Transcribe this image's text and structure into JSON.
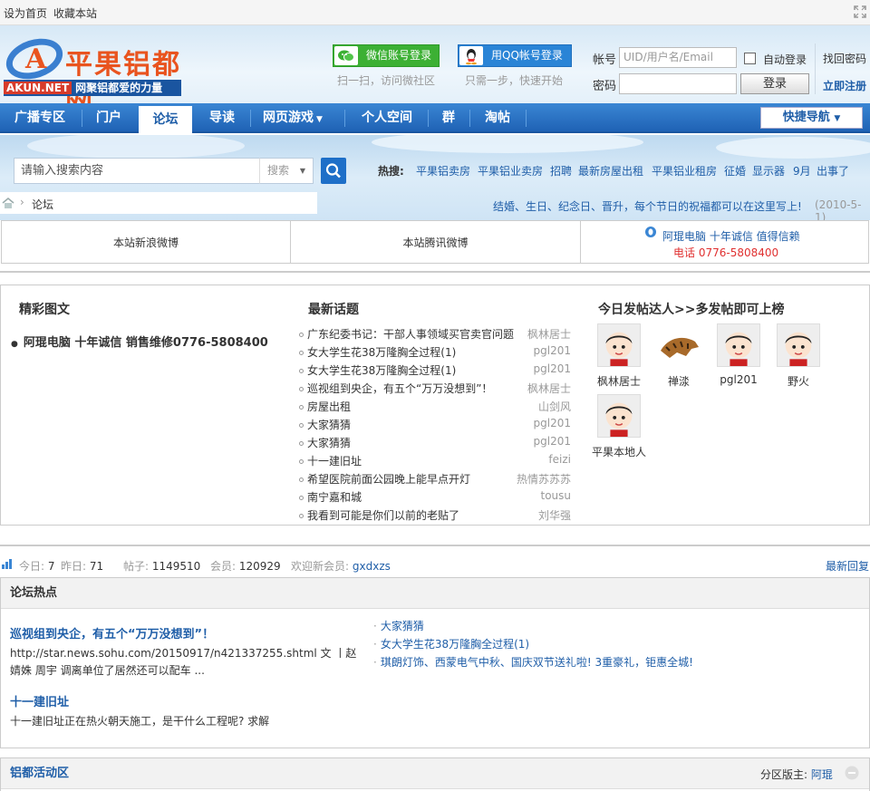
{
  "topbar": {
    "set_home": "设为首页",
    "bookmark": "收藏本站"
  },
  "brand": {
    "logo_text": "平果铝都网",
    "site_code": "AKUN.NET",
    "slogan": "网聚铝都爱的力量"
  },
  "social": {
    "wechat_btn": "微信账号登录",
    "wechat_tip": "扫一扫，访问微社区",
    "qq_btn": "用QQ帐号登录",
    "qq_tip": "只需一步，快速开始"
  },
  "login": {
    "username_label": "帐号",
    "username_placeholder": "UID/用户名/Email",
    "password_label": "密码",
    "password_value": "",
    "auto_login": "自动登录",
    "login_btn": "登录",
    "find_pwd": "找回密码",
    "register": "立即注册"
  },
  "nav": {
    "items": [
      "广播专区",
      "门户",
      "论坛",
      "导读",
      "网页游戏",
      "个人空间",
      "群",
      "淘帖"
    ],
    "active": "论坛",
    "quick": "快捷导航"
  },
  "search": {
    "placeholder": "请输入搜索内容",
    "scope": "搜索",
    "hot_label": "热搜:"
  },
  "hot_words": [
    "平果铝卖房",
    "平果铝业卖房",
    "招聘",
    "最新房屋出租",
    "平果铝业租房",
    "征婚",
    "显示器",
    "9月",
    "出事了"
  ],
  "breadcrumb": {
    "current": "论坛"
  },
  "notice": {
    "text": "结婚、生日、纪念日、晋升，每个节日的祝福都可以在这里写上!",
    "date": "(2010-5-1)"
  },
  "weibo": {
    "sina": "本站新浪微博",
    "tencent": "本站腾讯微博",
    "ad_line1": "阿琨电脑 十年诚信 值得信赖",
    "ad_phone_label": "电话",
    "ad_phone": "0776-5808400"
  },
  "featured": {
    "title": "精彩图文",
    "pick": "阿琨电脑 十年诚信 销售维修0776-5808400",
    "latest_title": "最新话题",
    "topics": [
      {
        "title": "广东纪委书记：干部人事领域买官卖官问题",
        "author": "枫林居士"
      },
      {
        "title": "女大学生花38万隆胸全过程(1)",
        "author": "pgl201"
      },
      {
        "title": "女大学生花38万隆胸全过程(1)",
        "author": "pgl201"
      },
      {
        "title": "巡视组到央企，有五个“万万没想到”！",
        "author": "枫林居士"
      },
      {
        "title": "房屋出租",
        "author": "山剑风"
      },
      {
        "title": "大家猜猜",
        "author": "pgl201"
      },
      {
        "title": "大家猜猜",
        "author": "pgl201"
      },
      {
        "title": "十一建旧址",
        "author": "feizi"
      },
      {
        "title": "希望医院前面公园晚上能早点开灯",
        "author": "热情苏苏苏"
      },
      {
        "title": "南宁嘉和城",
        "author": "tousu"
      },
      {
        "title": "我看到可能是你们以前的老贴了",
        "author": "刘华强"
      }
    ],
    "top_users_title": "今日发帖达人>>多发帖即可上榜",
    "users": [
      "枫林居士",
      "禅渁",
      "pgl201",
      "野火",
      "平果本地人"
    ]
  },
  "stats": {
    "today_label": "今日:",
    "today": "7",
    "yesterday_label": "昨日:",
    "yesterday": "71",
    "posts_label": "帖子:",
    "posts": "1149510",
    "members_label": "会员:",
    "members": "120929",
    "welcome_label": "欢迎新会员:",
    "new_member": "gxdxzs",
    "latest_reply": "最新回复"
  },
  "forum_hot": {
    "title": "论坛热点",
    "a1_title": "巡视组到央企，有五个“万万没想到”！",
    "a1_text1": "http://star.news.sohu.com/20150917/n421337255.shtml 文 丨赵",
    "a1_text2": "婧姝 周宇      调离单位了居然还可以配车 ...",
    "a2_title": "十一建旧址",
    "a2_text": "十一建旧址正在热火朝天施工，是干什么工程呢? 求解",
    "links": [
      "大家猜猜",
      "女大学生花38万隆胸全过程(1)",
      "琪朗灯饰、西蒙电气中秋、国庆双节送礼啦! 3重豪礼，钜惠全城!"
    ]
  },
  "activity": {
    "title": "铝都活动区",
    "moderator_label": "分区版主:",
    "moderator": "阿琨"
  }
}
